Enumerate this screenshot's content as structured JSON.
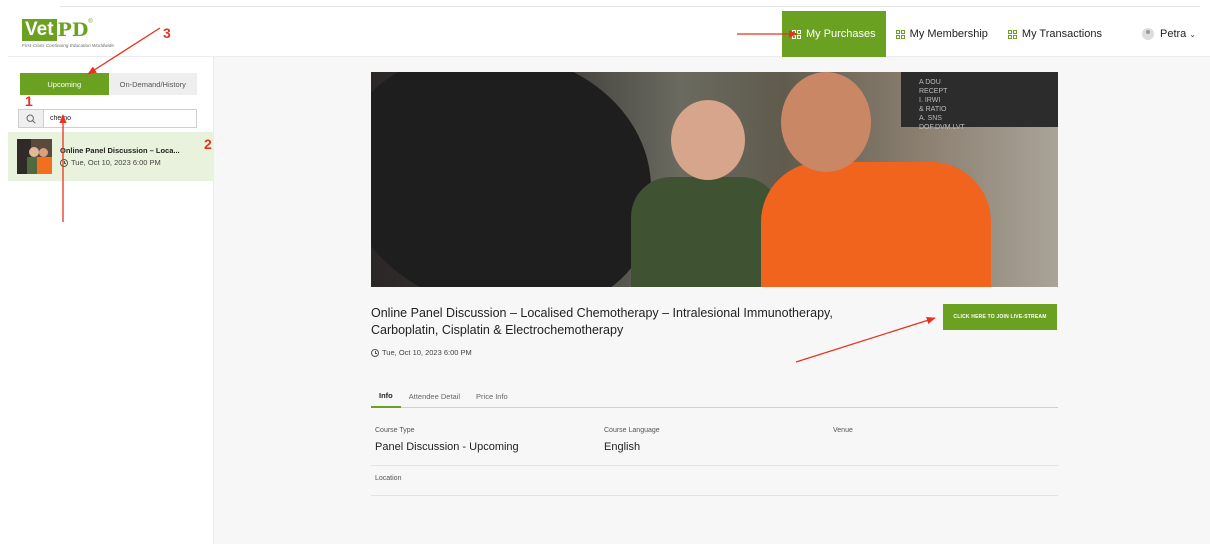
{
  "logo": {
    "main": "Vet",
    "pd": "PD",
    "tm": "®",
    "tagline": "First-Class Continuing Education Worldwide"
  },
  "nav": {
    "items": [
      {
        "label": "My Purchases",
        "active": true
      },
      {
        "label": "My Membership",
        "active": false
      },
      {
        "label": "My Transactions",
        "active": false
      }
    ],
    "user": {
      "name": "Petra",
      "chevron": "⌄"
    }
  },
  "sidebar": {
    "tabs": [
      {
        "label": "Upcoming",
        "active": true
      },
      {
        "label": "On-Demand/History",
        "active": false
      }
    ],
    "search": {
      "value": "chemo"
    },
    "items": [
      {
        "title": "Online Panel Discussion – Loca...",
        "date": "Tue, Oct 10, 2023 6:00 PM"
      }
    ]
  },
  "event": {
    "hero_board_text": "A DOU\nRECEPT\nI. IRWI\n& RATIO\nA. SNS\nDOF.DVM.LVT",
    "title": "Online Panel Discussion – Localised Chemotherapy – Intralesional Immunotherapy, Carboplatin, Cisplatin & Electrochemotherapy",
    "join_label": "CLICK HERE TO JOIN LIVE-STREAM",
    "date": "Tue, Oct 10, 2023 6:00 PM",
    "tabs": [
      {
        "label": "Info",
        "active": true
      },
      {
        "label": "Attendee Detail",
        "active": false
      },
      {
        "label": "Price Info",
        "active": false
      }
    ],
    "fields": {
      "course_type": {
        "label": "Course Type",
        "value": "Panel Discussion - Upcoming"
      },
      "course_language": {
        "label": "Course Language",
        "value": "English"
      },
      "venue": {
        "label": "Venue",
        "value": ""
      },
      "location": {
        "label": "Location",
        "value": ""
      }
    }
  },
  "annotations": {
    "one": "1",
    "two": "2",
    "three": "3",
    "color": "#e8321f"
  },
  "colors": {
    "accent": "#6aa121",
    "selected_row": "#e9f2dc"
  }
}
